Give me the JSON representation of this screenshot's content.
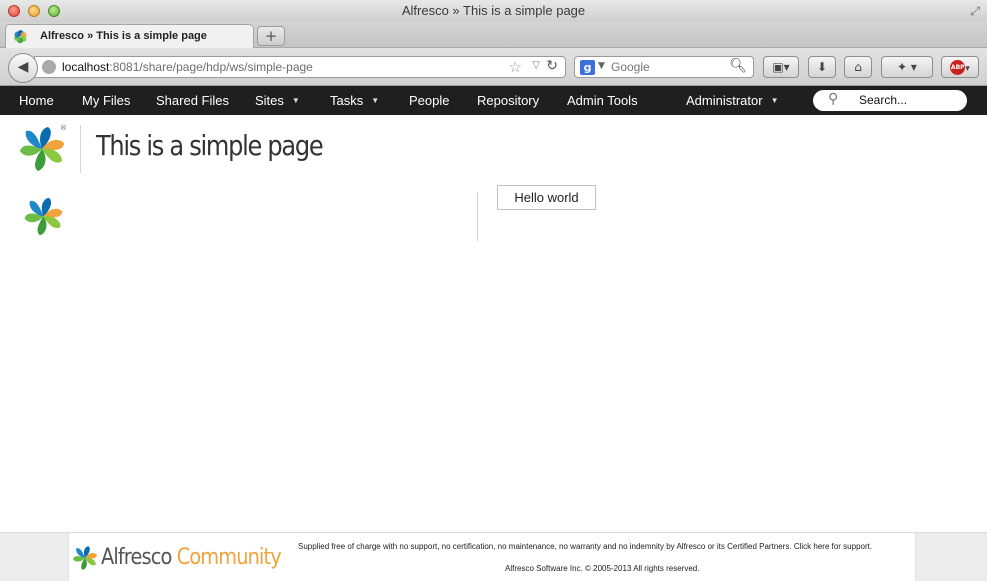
{
  "window": {
    "title": "Alfresco » This is a simple page"
  },
  "tabs": [
    {
      "label": "Alfresco » This is a simple page",
      "active": true
    }
  ],
  "browser": {
    "new_tab_label": "+",
    "url_host": "localhost",
    "url_rest": ":8081/share/page/hdp/ws/simple-page",
    "search_engine_label": "Google",
    "adblock_label": "ABP"
  },
  "app_nav": {
    "items": [
      {
        "label": "Home",
        "has_menu": false
      },
      {
        "label": "My Files",
        "has_menu": false
      },
      {
        "label": "Shared Files",
        "has_menu": false
      },
      {
        "label": "Sites",
        "has_menu": true
      },
      {
        "label": "Tasks",
        "has_menu": true
      },
      {
        "label": "People",
        "has_menu": false
      },
      {
        "label": "Repository",
        "has_menu": false
      },
      {
        "label": "Admin Tools",
        "has_menu": false
      }
    ],
    "user_menu": "Administrator",
    "search_placeholder": "Search..."
  },
  "page": {
    "title": "This is a simple page",
    "registered_mark": "®",
    "hello_button": "Hello world"
  },
  "footer": {
    "brand_name": "Alfresco",
    "brand_edition": "Community",
    "support_text": "Supplied free of charge with no support, no certification, no maintenance, no warranty and no indemnity by Alfresco or its Certified Partners. Click here for support.",
    "copyright_text": "Alfresco Software Inc. © 2005-2013 All rights reserved."
  },
  "colors": {
    "app_bar": "#1f1f1f",
    "brand_orange": "#f0a33a",
    "logo_blue": "#0b6db1",
    "logo_green": "#6cbd45"
  },
  "icons": [
    "close-icon",
    "minimize-icon",
    "maximize-icon",
    "fullscreen-icon",
    "back-arrow-icon",
    "globe-icon",
    "star-icon",
    "reload-icon",
    "magnifier-icon",
    "bookmarks-icon",
    "download-icon",
    "home-icon",
    "addon-icon",
    "alfresco-logo-icon",
    "search-icon",
    "chevron-down-icon"
  ]
}
